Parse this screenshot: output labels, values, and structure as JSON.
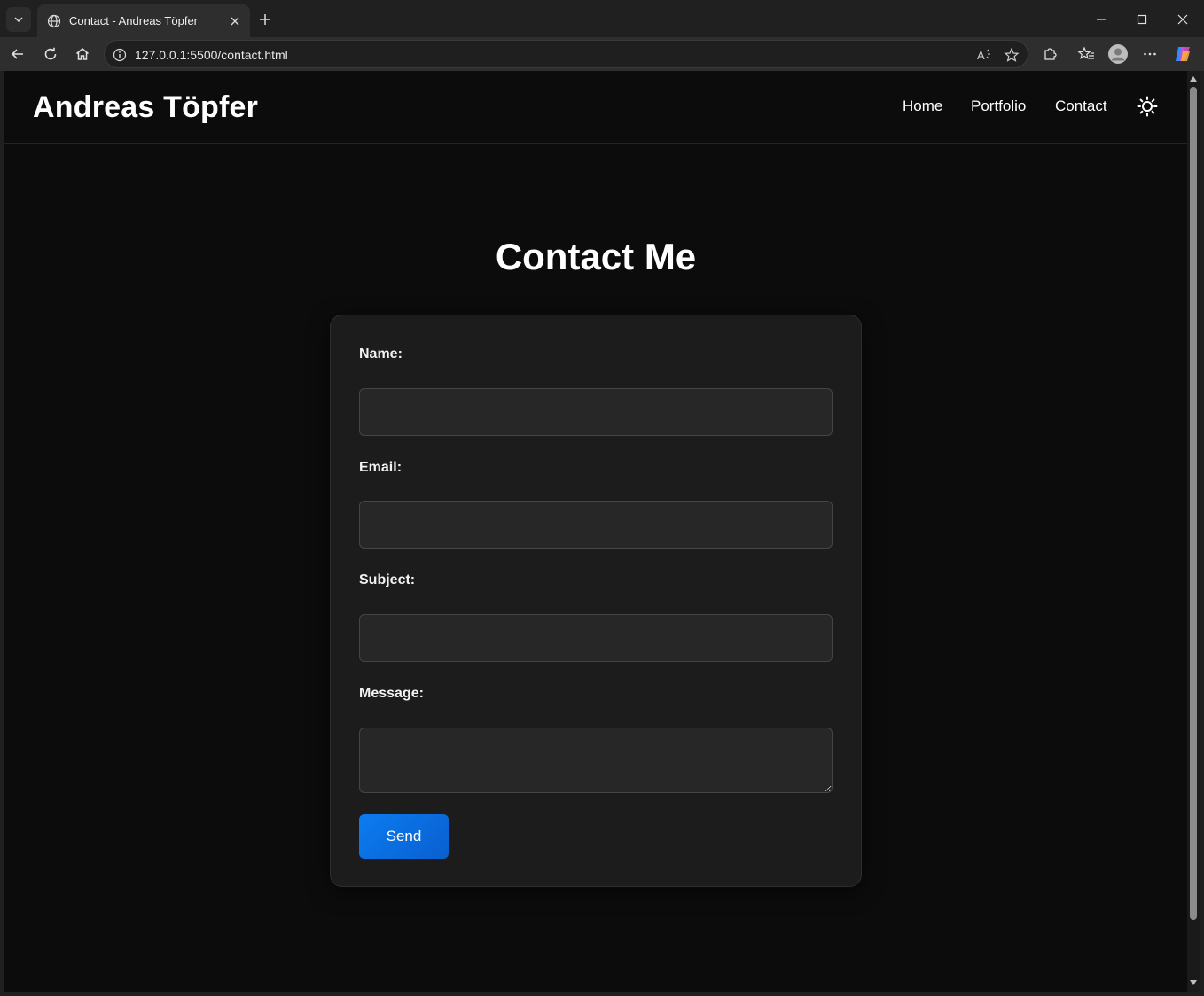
{
  "browser": {
    "tab": {
      "title": "Contact - Andreas Töpfer",
      "favicon": "globe-icon"
    },
    "address": {
      "url": "127.0.0.1:5500/contact.html"
    },
    "icons": {
      "tab_list": "chevron-down-icon",
      "close_tab": "close-icon",
      "new_tab": "plus-icon",
      "minimize": "minimize-icon",
      "maximize": "maximize-icon",
      "close_window": "close-icon",
      "back": "back-arrow-icon",
      "refresh": "refresh-icon",
      "home": "home-icon",
      "site_info": "info-icon",
      "read_aloud": "read-aloud-icon",
      "favorite": "star-icon",
      "extensions": "puzzle-icon",
      "favorites": "favorites-icon",
      "profile": "avatar-icon",
      "more": "more-icon",
      "copilot": "copilot-icon"
    }
  },
  "site": {
    "logo": "Andreas Töpfer",
    "nav": {
      "home": "Home",
      "portfolio": "Portfolio",
      "contact": "Contact"
    },
    "theme_toggle_icon": "sun-icon"
  },
  "main": {
    "title": "Contact Me",
    "form": {
      "name_label": "Name:",
      "name_value": "",
      "email_label": "Email:",
      "email_value": "",
      "subject_label": "Subject:",
      "subject_value": "",
      "message_label": "Message:",
      "message_value": "",
      "submit_label": "Send"
    }
  },
  "colors": {
    "page_background": "#0c0c0c",
    "card_background": "#1c1c1c",
    "input_background": "#272727",
    "accent": "#0b7cf0"
  }
}
